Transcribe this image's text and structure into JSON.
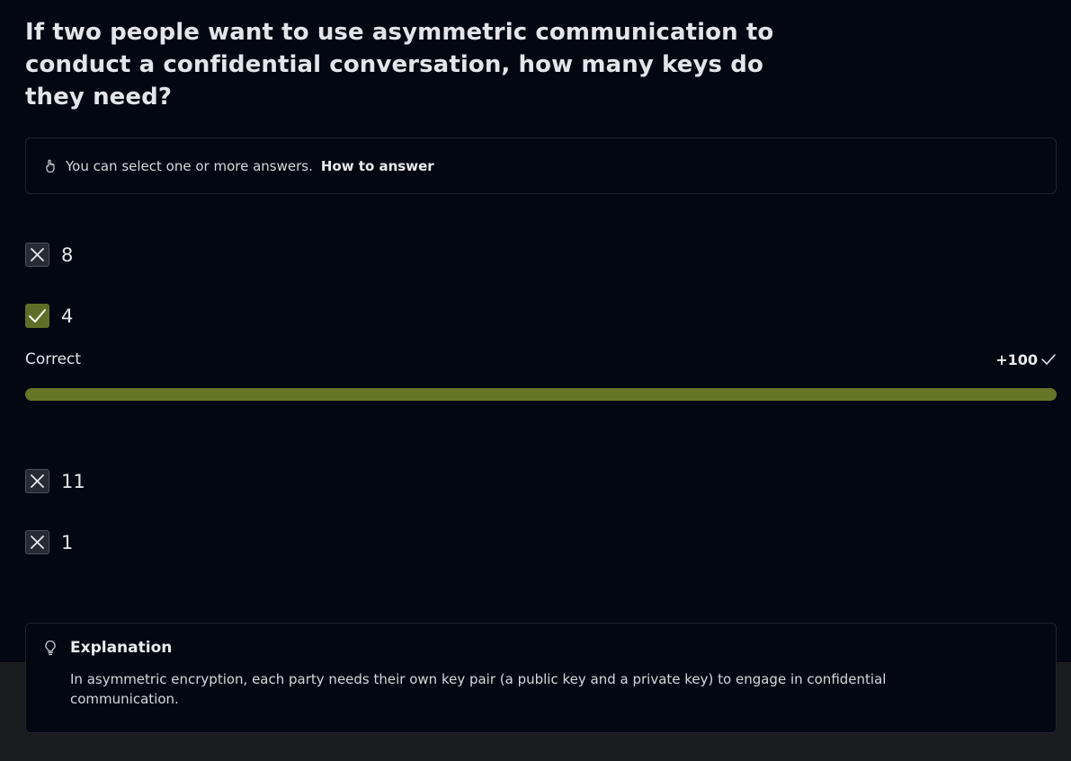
{
  "question": {
    "title": "If two people want to use asymmetric communication to conduct a confidential conversation, how many keys do they need?"
  },
  "hint": {
    "text": "You can select one or more answers.",
    "link": "How to answer"
  },
  "options": [
    {
      "label": "8",
      "state": "incorrect"
    },
    {
      "label": "4",
      "state": "correct"
    },
    {
      "label": "11",
      "state": "incorrect"
    },
    {
      "label": "1",
      "state": "incorrect"
    }
  ],
  "result": {
    "label": "Correct",
    "points": "+100",
    "progress_percent": 100
  },
  "explanation": {
    "title": "Explanation",
    "body": "In asymmetric encryption, each party needs their own key pair (a public key and a private key) to engage in confidential communication."
  },
  "colors": {
    "background": "#030711",
    "accent": "#667526",
    "border": "#1f2430"
  },
  "icons": {
    "hint": "hand-pointer-icon",
    "wrong": "x-mark-icon",
    "right": "checkmark-icon",
    "points": "check-icon",
    "explanation": "lightbulb-icon"
  }
}
